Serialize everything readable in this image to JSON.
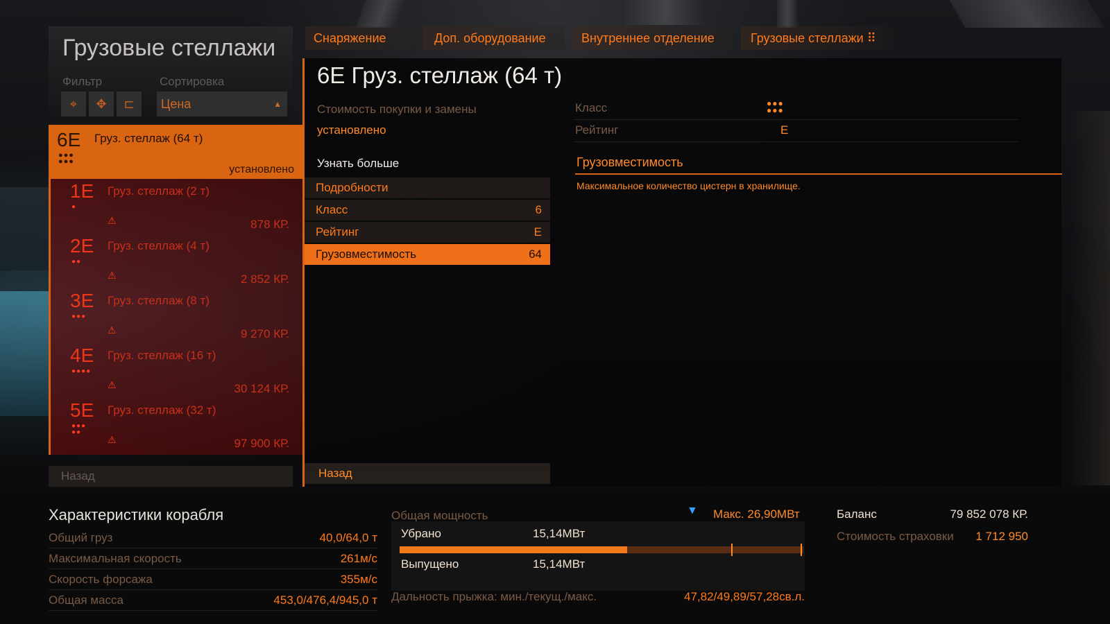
{
  "colors": {
    "accent": "#d96513",
    "text": "#ff7a1a",
    "danger": "#c8301a",
    "bg": "#0b0d0f"
  },
  "left": {
    "title": "Грузовые стеллажи",
    "filter_label": "Фильтр",
    "sort_label": "Сортировка",
    "filter_icons": [
      "crosshair-icon",
      "target-icon",
      "tag-icon"
    ],
    "sort_value": "Цена",
    "selected": {
      "code": "6E",
      "dots": "●●●\n●●●",
      "name": "Груз. стеллаж (64 т)",
      "status": "установлено"
    },
    "items": [
      {
        "code": "1E",
        "dots": "●",
        "name": "Груз. стеллаж (2 т)",
        "price": "878 КР."
      },
      {
        "code": "2E",
        "dots": "●●",
        "name": "Груз. стеллаж (4 т)",
        "price": "2 852 КР."
      },
      {
        "code": "3E",
        "dots": "●●●",
        "name": "Груз. стеллаж (8 т)",
        "price": "9 270 КР."
      },
      {
        "code": "4E",
        "dots": "●●●●",
        "name": "Груз. стеллаж (16 т)",
        "price": "30 124 КР."
      },
      {
        "code": "5E",
        "dots": "●●●\n●●",
        "name": "Груз. стеллаж (32 т)",
        "price": "97 900 КР."
      }
    ],
    "back": "Назад"
  },
  "tabs": [
    "Снаряжение",
    "Доп. оборудование",
    "Внутреннее отделение",
    "Грузовые стеллажи ⠿"
  ],
  "detail": {
    "title": "6E Груз. стеллаж (64 т)",
    "cost_label": "Стоимость покупки и замены",
    "cost_value": "установлено",
    "learn_more": "Узнать больше",
    "rows": [
      {
        "k": "Подробности",
        "v": ""
      },
      {
        "k": "Класс",
        "v": "6"
      },
      {
        "k": "Рейтинг",
        "v": "E"
      },
      {
        "k": "Грузовместимость",
        "v": "64"
      }
    ],
    "back": "Назад",
    "class_label": "Класс",
    "class_dots": "●●●\n●●●",
    "rating_label": "Рейтинг",
    "rating_value": "E",
    "capacity_title": "Грузовместимость",
    "capacity_desc": "Максимальное количество цистерн в хранилище."
  },
  "ship": {
    "title": "Характеристики корабля",
    "stats": [
      {
        "k": "Общий груз",
        "v": "40,0/64,0 т"
      },
      {
        "k": "Максимальная скорость",
        "v": "261м/с"
      },
      {
        "k": "Скорость форсажа",
        "v": "355м/с"
      },
      {
        "k": "Общая масса",
        "v": "453,0/476,4/945,0 т"
      }
    ]
  },
  "power": {
    "label": "Общая мощность",
    "max": "Макс. 26,90МВт",
    "retracted_label": "Убрано",
    "retracted_value": "15,14МВт",
    "deployed_label": "Выпущено",
    "deployed_value": "15,14МВт",
    "usage_fraction": 0.5628,
    "jump_label": "Дальность прыжка: мин./текущ./макс.",
    "jump_value": "47,82/49,89/57,28св.л."
  },
  "balance": {
    "label": "Баланс",
    "value": "79 852 078 КР.",
    "insurance_label": "Стоимость страховки",
    "insurance_value": "1 712 950"
  }
}
